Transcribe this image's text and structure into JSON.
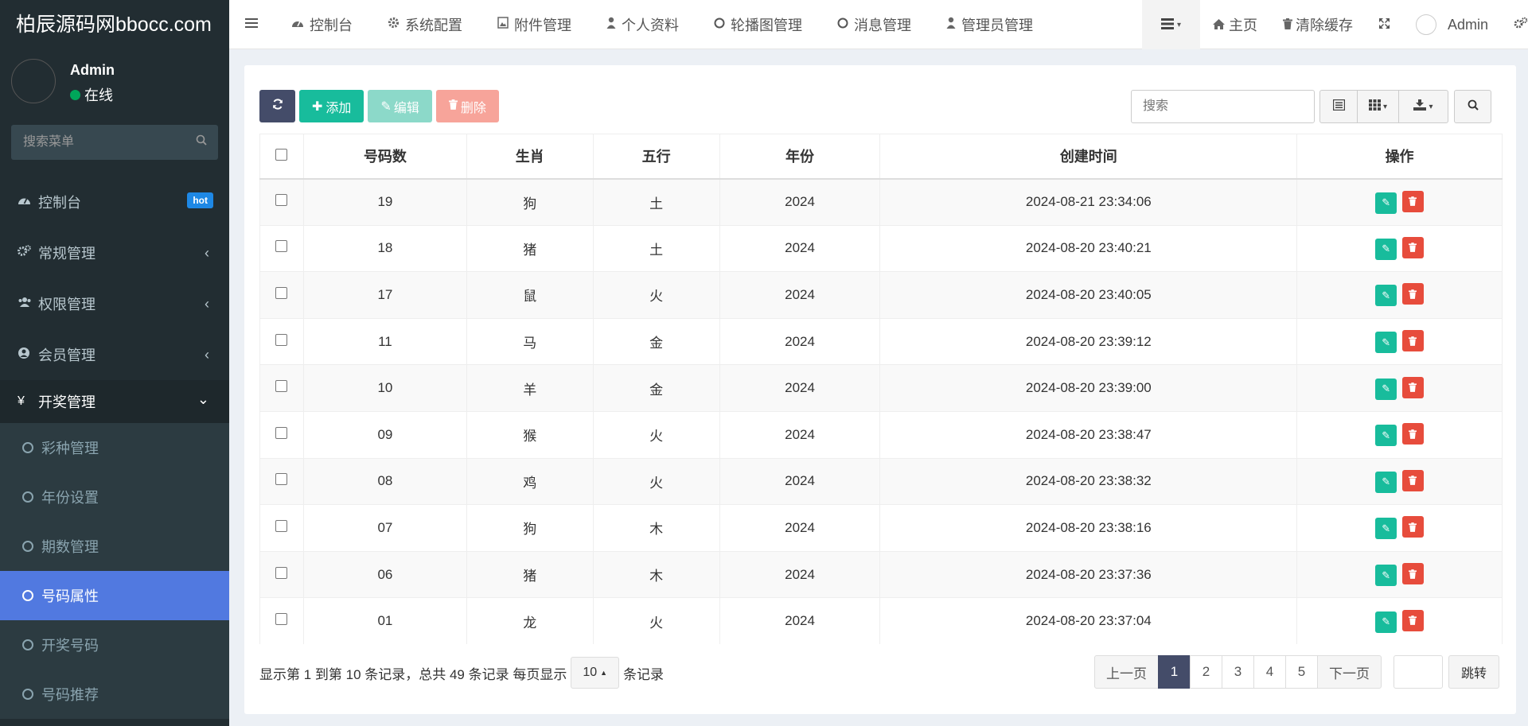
{
  "site": {
    "title": "柏辰源码网bbocc.com"
  },
  "user": {
    "name": "Admin",
    "status": "在线"
  },
  "sidebar": {
    "search_placeholder": "搜索菜单",
    "menu": [
      {
        "label": "控制台",
        "icon": "dashboard-icon",
        "badge": "hot"
      },
      {
        "label": "常规管理",
        "icon": "cogs-icon"
      },
      {
        "label": "权限管理",
        "icon": "users-icon"
      },
      {
        "label": "会员管理",
        "icon": "user-circle-icon"
      },
      {
        "label": "开奖管理",
        "icon": "yen-icon"
      }
    ],
    "submenu": [
      {
        "label": "彩种管理"
      },
      {
        "label": "年份设置"
      },
      {
        "label": "期数管理"
      },
      {
        "label": "号码属性",
        "active": true
      },
      {
        "label": "开奖号码"
      },
      {
        "label": "号码推荐"
      }
    ]
  },
  "topnav": {
    "tabs": [
      {
        "label": "控制台",
        "icon": "dashboard-icon"
      },
      {
        "label": "系统配置",
        "icon": "gear-icon"
      },
      {
        "label": "附件管理",
        "icon": "image-icon"
      },
      {
        "label": "个人资料",
        "icon": "user-icon"
      },
      {
        "label": "轮播图管理",
        "icon": "circle-icon"
      },
      {
        "label": "消息管理",
        "icon": "circle-icon"
      },
      {
        "label": "管理员管理",
        "icon": "user-icon"
      }
    ],
    "right": {
      "home": "主页",
      "clear_cache": "清除缓存",
      "admin": "Admin"
    }
  },
  "toolbar": {
    "add": "添加",
    "edit": "编辑",
    "delete": "删除",
    "search_placeholder": "搜索"
  },
  "table": {
    "headers": [
      "号码数",
      "生肖",
      "五行",
      "年份",
      "创建时间",
      "操作"
    ],
    "rows": [
      {
        "num": "19",
        "zodiac": "狗",
        "element": "土",
        "year": "2024",
        "created": "2024-08-21 23:34:06"
      },
      {
        "num": "18",
        "zodiac": "猪",
        "element": "土",
        "year": "2024",
        "created": "2024-08-20 23:40:21"
      },
      {
        "num": "17",
        "zodiac": "鼠",
        "element": "火",
        "year": "2024",
        "created": "2024-08-20 23:40:05"
      },
      {
        "num": "11",
        "zodiac": "马",
        "element": "金",
        "year": "2024",
        "created": "2024-08-20 23:39:12"
      },
      {
        "num": "10",
        "zodiac": "羊",
        "element": "金",
        "year": "2024",
        "created": "2024-08-20 23:39:00"
      },
      {
        "num": "09",
        "zodiac": "猴",
        "element": "火",
        "year": "2024",
        "created": "2024-08-20 23:38:47"
      },
      {
        "num": "08",
        "zodiac": "鸡",
        "element": "火",
        "year": "2024",
        "created": "2024-08-20 23:38:32"
      },
      {
        "num": "07",
        "zodiac": "狗",
        "element": "木",
        "year": "2024",
        "created": "2024-08-20 23:38:16"
      },
      {
        "num": "06",
        "zodiac": "猪",
        "element": "木",
        "year": "2024",
        "created": "2024-08-20 23:37:36"
      },
      {
        "num": "01",
        "zodiac": "龙",
        "element": "火",
        "year": "2024",
        "created": "2024-08-20 23:37:04"
      }
    ]
  },
  "footer": {
    "info_prefix": "显示第 1 到第 10 条记录，总共 49 条记录 每页显示",
    "page_size": "10",
    "info_suffix": "条记录",
    "prev": "上一页",
    "pages": [
      "1",
      "2",
      "3",
      "4",
      "5"
    ],
    "current_page": "1",
    "next": "下一页",
    "jump": "跳转"
  },
  "colors": {
    "sidebar_bg": "#222d32",
    "active_menu": "#5179e0",
    "success": "#18bc9c",
    "danger": "#e74c3c",
    "primary": "#444c69"
  }
}
